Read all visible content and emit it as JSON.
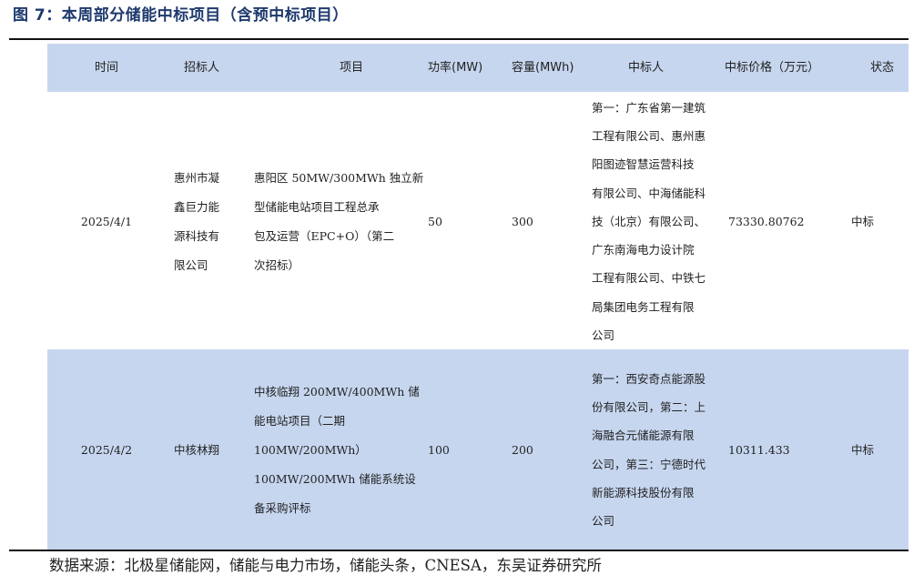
{
  "figure_title": "图 7：本周部分储能中标项目（含预中标项目）",
  "table": {
    "headers": {
      "time": "时间",
      "buyer": "招标人",
      "project": "项目",
      "power": "功率(MW)",
      "capacity": "容量(MWh)",
      "winner": "中标人",
      "price": "中标价格（万元）",
      "status": "状态"
    },
    "rows": [
      {
        "time": "2025/4/1",
        "buyer": "惠州市凝\n鑫巨力能\n源科技有\n限公司",
        "project": "惠阳区 50MW/300MWh 独立新\n型储能电站项目工程总承\n包及运营（EPC+O）（第二\n次招标）",
        "power": "50",
        "capacity": "300",
        "winner": "第一：广东省第一建筑\n工程有限公司、惠州惠\n阳图迹智慧运营科技\n有限公司、中海储能科\n技（北京）有限公司、\n广东南海电力设计院\n工程有限公司、中铁七\n局集团电务工程有限\n公司",
        "price": "73330.80762",
        "status": "中标"
      },
      {
        "time": "2025/4/2",
        "buyer": "中核林翔",
        "project": "中核临翔 200MW/400MWh 储\n能电站项目（二期\n100MW/200MWh）\n100MW/200MWh 储能系统设\n备采购评标",
        "power": "100",
        "capacity": "200",
        "winner": "第一：西安奇点能源股\n份有限公司，第二：上\n海融合元储能源有限\n公司，第三：宁德时代\n新能源科技股份有限\n公司",
        "price": "10311.433",
        "status": "中标"
      }
    ]
  },
  "source_note": "数据来源：北极星储能网，储能与电力市场，储能头条，CNESA，东吴证券研究所"
}
